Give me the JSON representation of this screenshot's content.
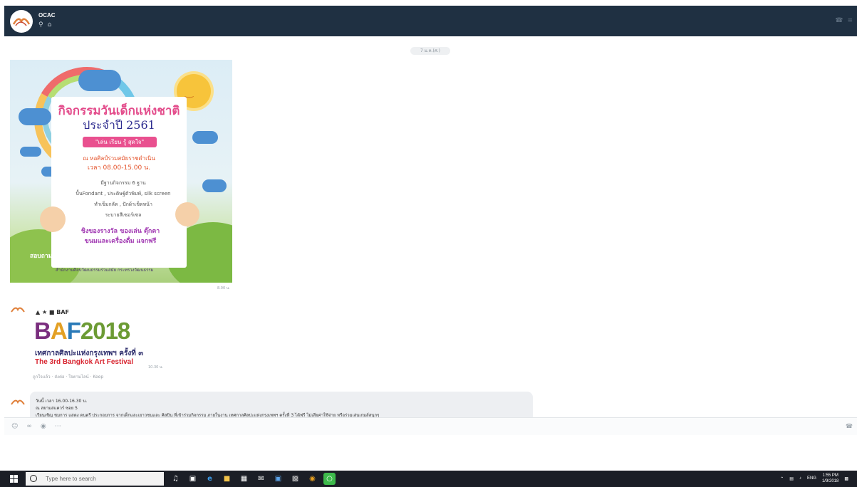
{
  "header": {
    "title": "OCAC",
    "icons": [
      "search-icon",
      "home-icon"
    ]
  },
  "date_chip": "7 ม.ค.(ศ.)",
  "poster": {
    "title": "กิจกรรมวันเด็กแห่งชาติ",
    "year": "ประจำปี 2561",
    "tag": "\"เล่น เรียน รู้ สุดใจ\"",
    "venue": "ณ หอศิลป์ร่วมสมัยราชดำเนิน",
    "time": "เวลา 08.00-15.00 น.",
    "activities": [
      "มีฐานกิจกรรม 6 ฐาน",
      "ปั้นFondant , ประดิษฐ์ตัวพิมพ์, silk screen",
      "ทำเข็มกลัด , ปักผ้าเช็ดหน้า",
      "ระบายสีเซอร์เซล"
    ],
    "prizes": [
      "ชิงของรางวัล ของเล่น ตุ๊กตา",
      "ขนมและเครื่องดื่ม แจกฟรี"
    ],
    "contact": "สอบถามเพิ่มเติม 0 2209 3761-2",
    "org": "สำนักงานศิลปวัฒนธรรมร่วมสมัย กระทรวงวัฒนธรรม",
    "timestamp": "8.00 น."
  },
  "baf": {
    "logos": "BAF",
    "big": "2018",
    "thai": "เทศกาลศิลปะแห่งกรุงเทพฯ ครั้งที่ ๓",
    "en": "The 3rd Bangkok Art Festival",
    "timestamp": "10.30 น.",
    "links": "ถูกใจแล้ว · ส่งต่อ · ใจตามไลน์ · Keep"
  },
  "bubble": {
    "line1": "วันนี้ เวลา 16.00-16.30 น.",
    "line2": "ณ สยามสแควร์ ซอย 5",
    "line3": "เรียนเชิญ ชมการ แสดง ดนตรี ประกอบการ จากเด็กและเยาวชนและ ศิลปิน ที่เข้าร่วมกิจกรรม ภายในงาน เทศกาลศิลปะแห่งกรุงเทพฯ ครั้งที่ 3 ได้ฟรี ไม่เสียค่าใช้จ่าย หรือร่วมเล่นเกมส์สนุกๆ"
  },
  "input_icons": [
    "emoji-icon",
    "attach-icon",
    "camera-icon",
    "more-icon"
  ],
  "taskbar": {
    "search_placeholder": "Type here to search",
    "lang": "ENG",
    "time": "1:55 PM",
    "date": "1/9/2018"
  }
}
